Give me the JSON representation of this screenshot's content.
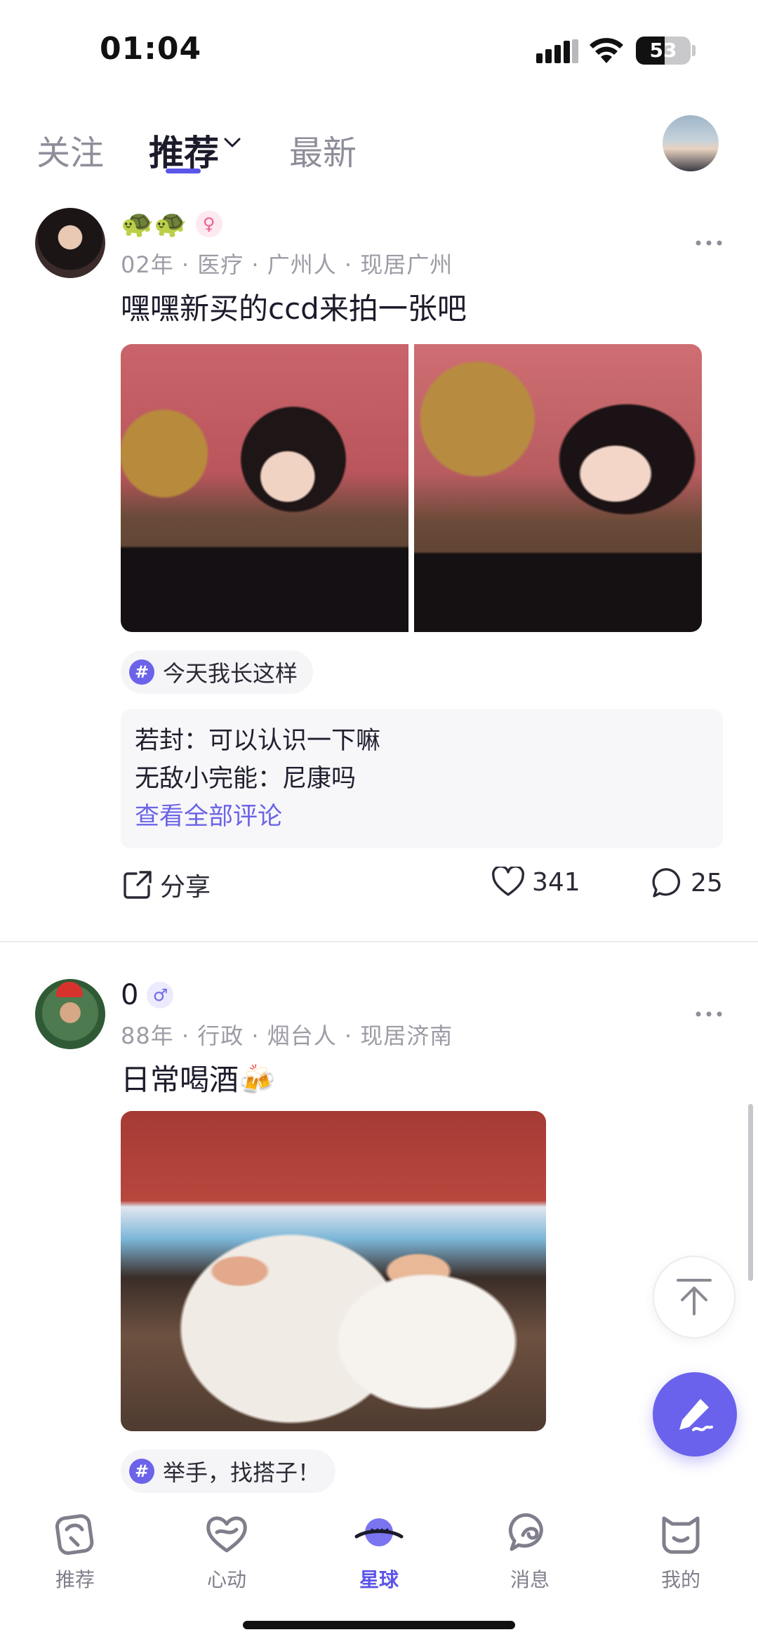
{
  "status_bar": {
    "time": "01:04",
    "battery": "53",
    "battery_level": 0.53
  },
  "top_tabs": {
    "items": [
      {
        "label": "关注"
      },
      {
        "label": "推荐"
      },
      {
        "label": "最新"
      }
    ],
    "active": "推荐"
  },
  "posts": [
    {
      "display_name": "🐢🐢",
      "gender": "female",
      "gender_symbol": "♀",
      "meta": "02年 · 医疗 · 广州人 · 现居广州",
      "caption": "嘿嘿新买的ccd来拍一张吧",
      "topic": "今天我长这样",
      "comments": [
        {
          "text": "若封：可以认识一下嘛"
        },
        {
          "text": "无敌小完能：尼康吗"
        }
      ],
      "view_all_comments": "查看全部评论",
      "share_label": "分享",
      "likes": "341",
      "comment_count": "25"
    },
    {
      "display_name": "0",
      "gender": "male",
      "gender_symbol": "♂",
      "meta": "88年 · 行政 · 烟台人 · 现居济南",
      "caption": "日常喝酒🍻",
      "topic": "举手，找搭子！"
    }
  ],
  "bottom_nav": {
    "items": [
      {
        "label": "推荐",
        "icon": "recommend-icon"
      },
      {
        "label": "心动",
        "icon": "heartbeat-icon"
      },
      {
        "label": "星球",
        "icon": "planet-icon"
      },
      {
        "label": "消息",
        "icon": "message-icon"
      },
      {
        "label": "我的",
        "icon": "profile-icon"
      }
    ],
    "active": "星球"
  },
  "colors": {
    "accent": "#5b55e8",
    "fab": "#6a62ec",
    "female": "#ee5f8c"
  }
}
